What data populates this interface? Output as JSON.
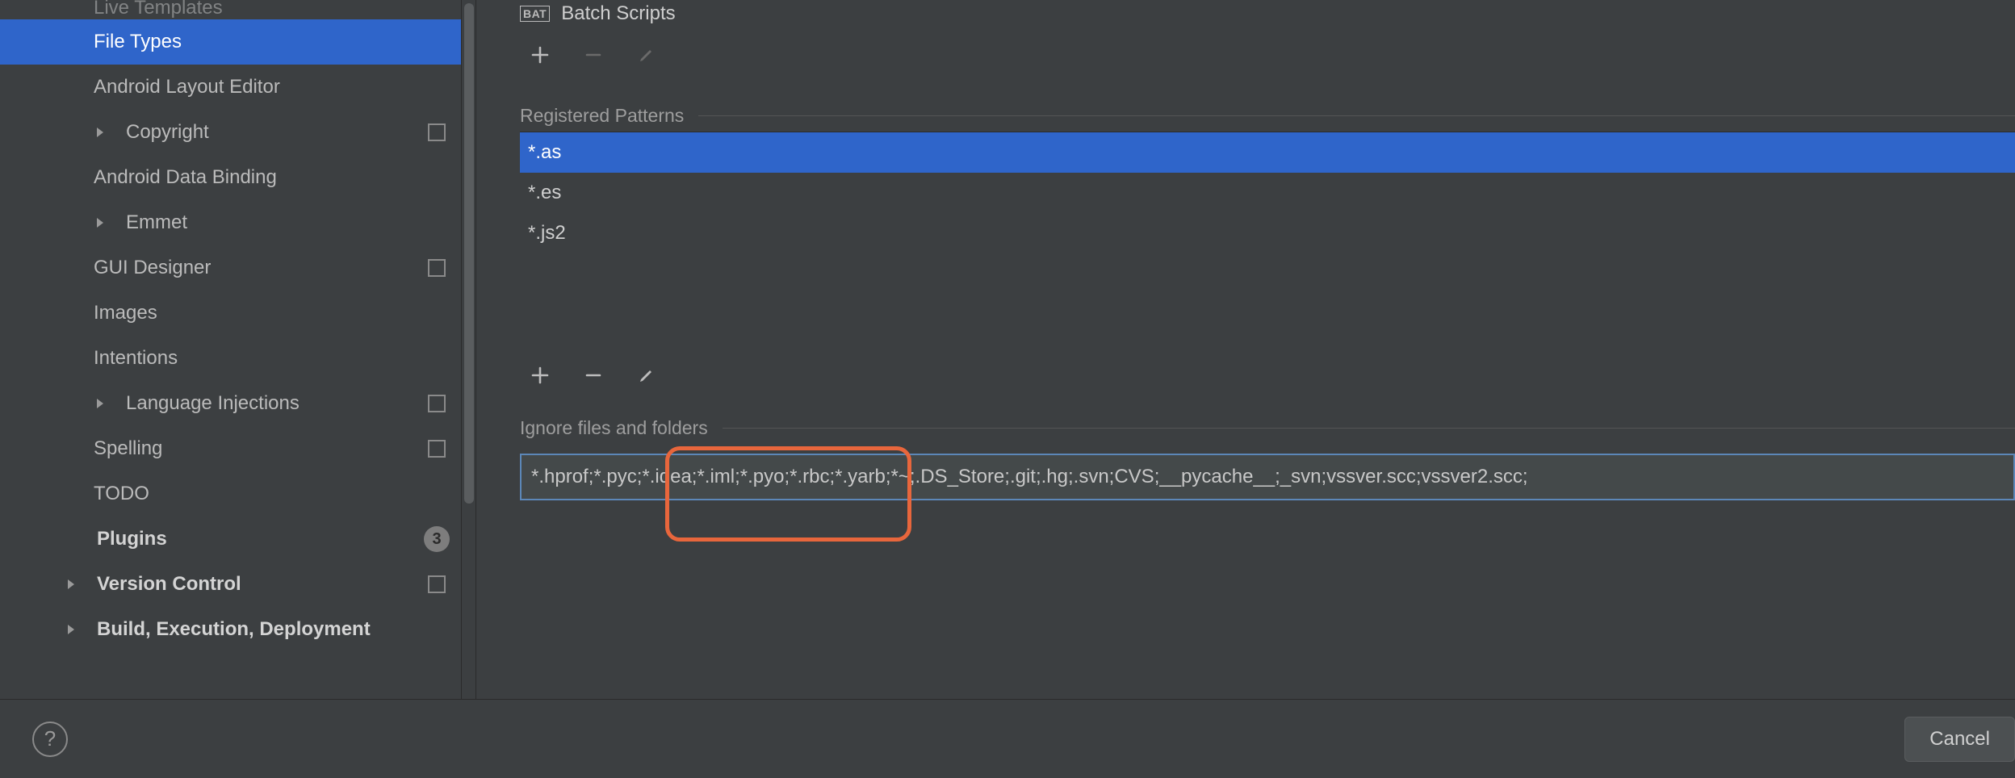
{
  "sidebar": {
    "items": [
      {
        "label": "Live Templates",
        "indent": 2,
        "arrow": false,
        "trailing": null,
        "selected": false
      },
      {
        "label": "File Types",
        "indent": 2,
        "arrow": false,
        "trailing": null,
        "selected": true
      },
      {
        "label": "Android Layout Editor",
        "indent": 2,
        "arrow": false,
        "trailing": null,
        "selected": false
      },
      {
        "label": "Copyright",
        "indent": 2,
        "arrow": true,
        "trailing": "copy",
        "selected": false
      },
      {
        "label": "Android Data Binding",
        "indent": 2,
        "arrow": false,
        "trailing": null,
        "selected": false
      },
      {
        "label": "Emmet",
        "indent": 2,
        "arrow": true,
        "trailing": null,
        "selected": false
      },
      {
        "label": "GUI Designer",
        "indent": 2,
        "arrow": false,
        "trailing": "copy",
        "selected": false
      },
      {
        "label": "Images",
        "indent": 2,
        "arrow": false,
        "trailing": null,
        "selected": false
      },
      {
        "label": "Intentions",
        "indent": 2,
        "arrow": false,
        "trailing": null,
        "selected": false
      },
      {
        "label": "Language Injections",
        "indent": 2,
        "arrow": true,
        "trailing": "copy",
        "selected": false
      },
      {
        "label": "Spelling",
        "indent": 2,
        "arrow": false,
        "trailing": "copy",
        "selected": false
      },
      {
        "label": "TODO",
        "indent": 2,
        "arrow": false,
        "trailing": null,
        "selected": false
      },
      {
        "label": "Plugins",
        "indent": 1,
        "arrow": false,
        "trailing": "badge",
        "badge": "3",
        "selected": false,
        "bold": true
      },
      {
        "label": "Version Control",
        "indent": 1,
        "arrow": true,
        "trailing": "copy",
        "selected": false,
        "bold": true
      },
      {
        "label": "Build, Execution, Deployment",
        "indent": 1,
        "arrow": true,
        "trailing": null,
        "selected": false,
        "bold": true
      }
    ]
  },
  "right": {
    "filetype_badge": "BAT",
    "filetype_label": "Batch Scripts",
    "patterns_label": "Registered Patterns",
    "patterns": [
      "*.as",
      "*.es",
      "*.js2"
    ],
    "patterns_selected_index": 0,
    "ignore_label": "Ignore files and folders",
    "ignore_value": "*.hprof;*.pyc;*.idea;*.iml;*.pyo;*.rbc;*.yarb;*~;.DS_Store;.git;.hg;.svn;CVS;__pycache__;_svn;vssver.scc;vssver2.scc;"
  },
  "footer": {
    "cancel": "Cancel"
  }
}
